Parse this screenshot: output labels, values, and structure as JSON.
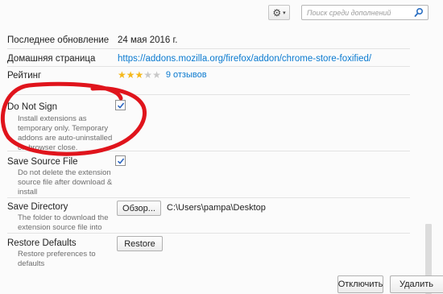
{
  "toolbar": {
    "gear_icon": "⚙",
    "gear_caret": "▾",
    "search_placeholder": "Поиск среди дополнений"
  },
  "details": {
    "last_updated_label": "Последнее обновление",
    "last_updated_value": "24 мая 2016 г.",
    "homepage_label": "Домашняя страница",
    "homepage_value": "https://addons.mozilla.org/firefox/addon/chrome-store-foxified/",
    "rating_label": "Рейтинг",
    "rating_stars": 3,
    "rating_max": 5,
    "reviews_link": "9 отзывов"
  },
  "options": [
    {
      "label": "Do Not Sign",
      "description": "Install extensions as temporary only. Temporary addons are auto-uninstalled on browser close.",
      "checked": true
    },
    {
      "label": "Save Source File",
      "description": "Do not delete the extension source file after download & install",
      "checked": true
    },
    {
      "label": "Save Directory",
      "description": "The folder to download the extension source file into",
      "browse_label": "Обзор...",
      "path_value": "C:\\Users\\pampa\\Desktop"
    },
    {
      "label": "Restore Defaults",
      "description": "Restore preferences to defaults",
      "button_label": "Restore"
    }
  ],
  "footer": {
    "disable_label": "Отключить",
    "remove_label": "Удалить"
  },
  "colors": {
    "link": "#0a7ad0",
    "star": "#f5b81a",
    "annotation": "#e0141c"
  }
}
